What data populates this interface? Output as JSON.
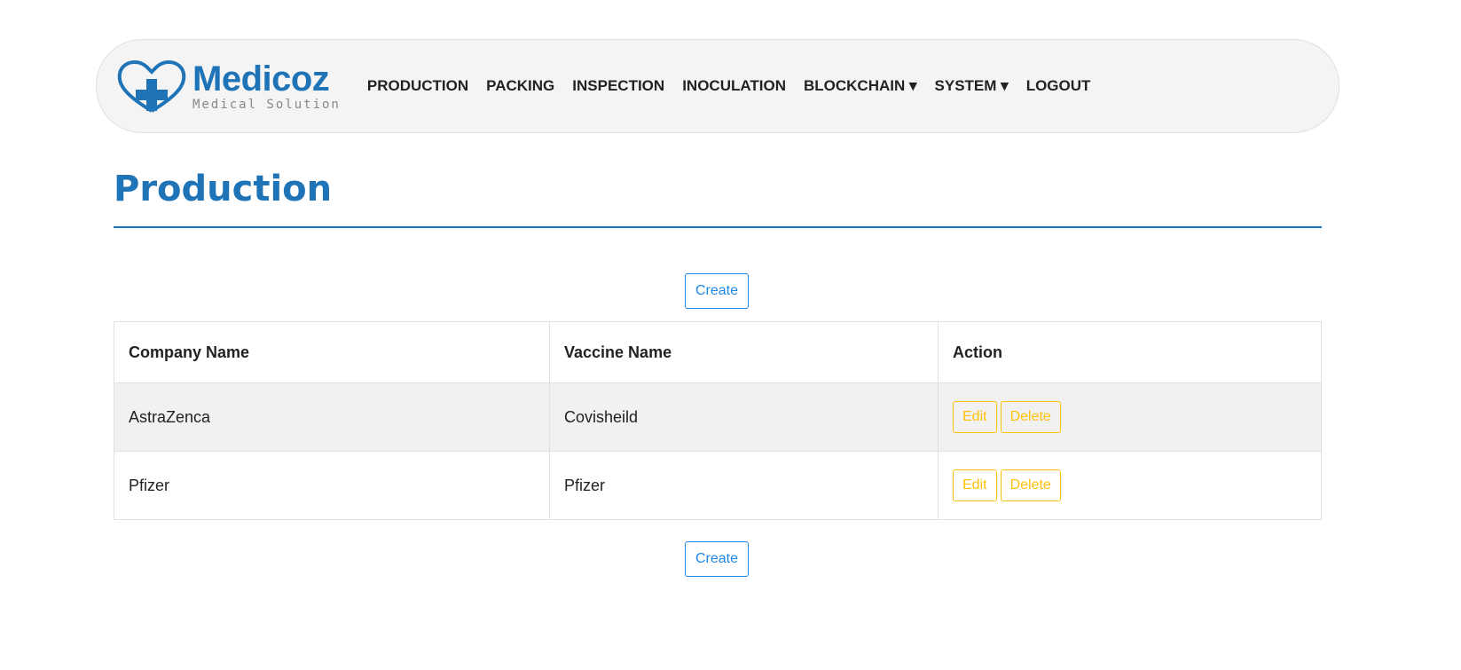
{
  "nav": {
    "brand": "Medicoz",
    "tagline": "Medical Solution",
    "items": [
      {
        "label": "PRODUCTION"
      },
      {
        "label": "PACKING"
      },
      {
        "label": "INSPECTION"
      },
      {
        "label": "INOCULATION"
      },
      {
        "label": "BLOCKCHAIN ▾"
      },
      {
        "label": "SYSTEM ▾"
      },
      {
        "label": "LOGOUT"
      }
    ]
  },
  "page": {
    "title": "Production",
    "create_label": "Create"
  },
  "table": {
    "headers": [
      "Company Name",
      "Vaccine Name",
      "Action"
    ],
    "rows": [
      {
        "company": "AstraZenca",
        "vaccine": "Covisheild"
      },
      {
        "company": "Pfizer",
        "vaccine": "Pfizer"
      }
    ],
    "edit_label": "Edit",
    "delete_label": "Delete"
  },
  "colors": {
    "primary": "#1f73b7",
    "warning": "#ffc107",
    "button": "#1e88e5"
  }
}
